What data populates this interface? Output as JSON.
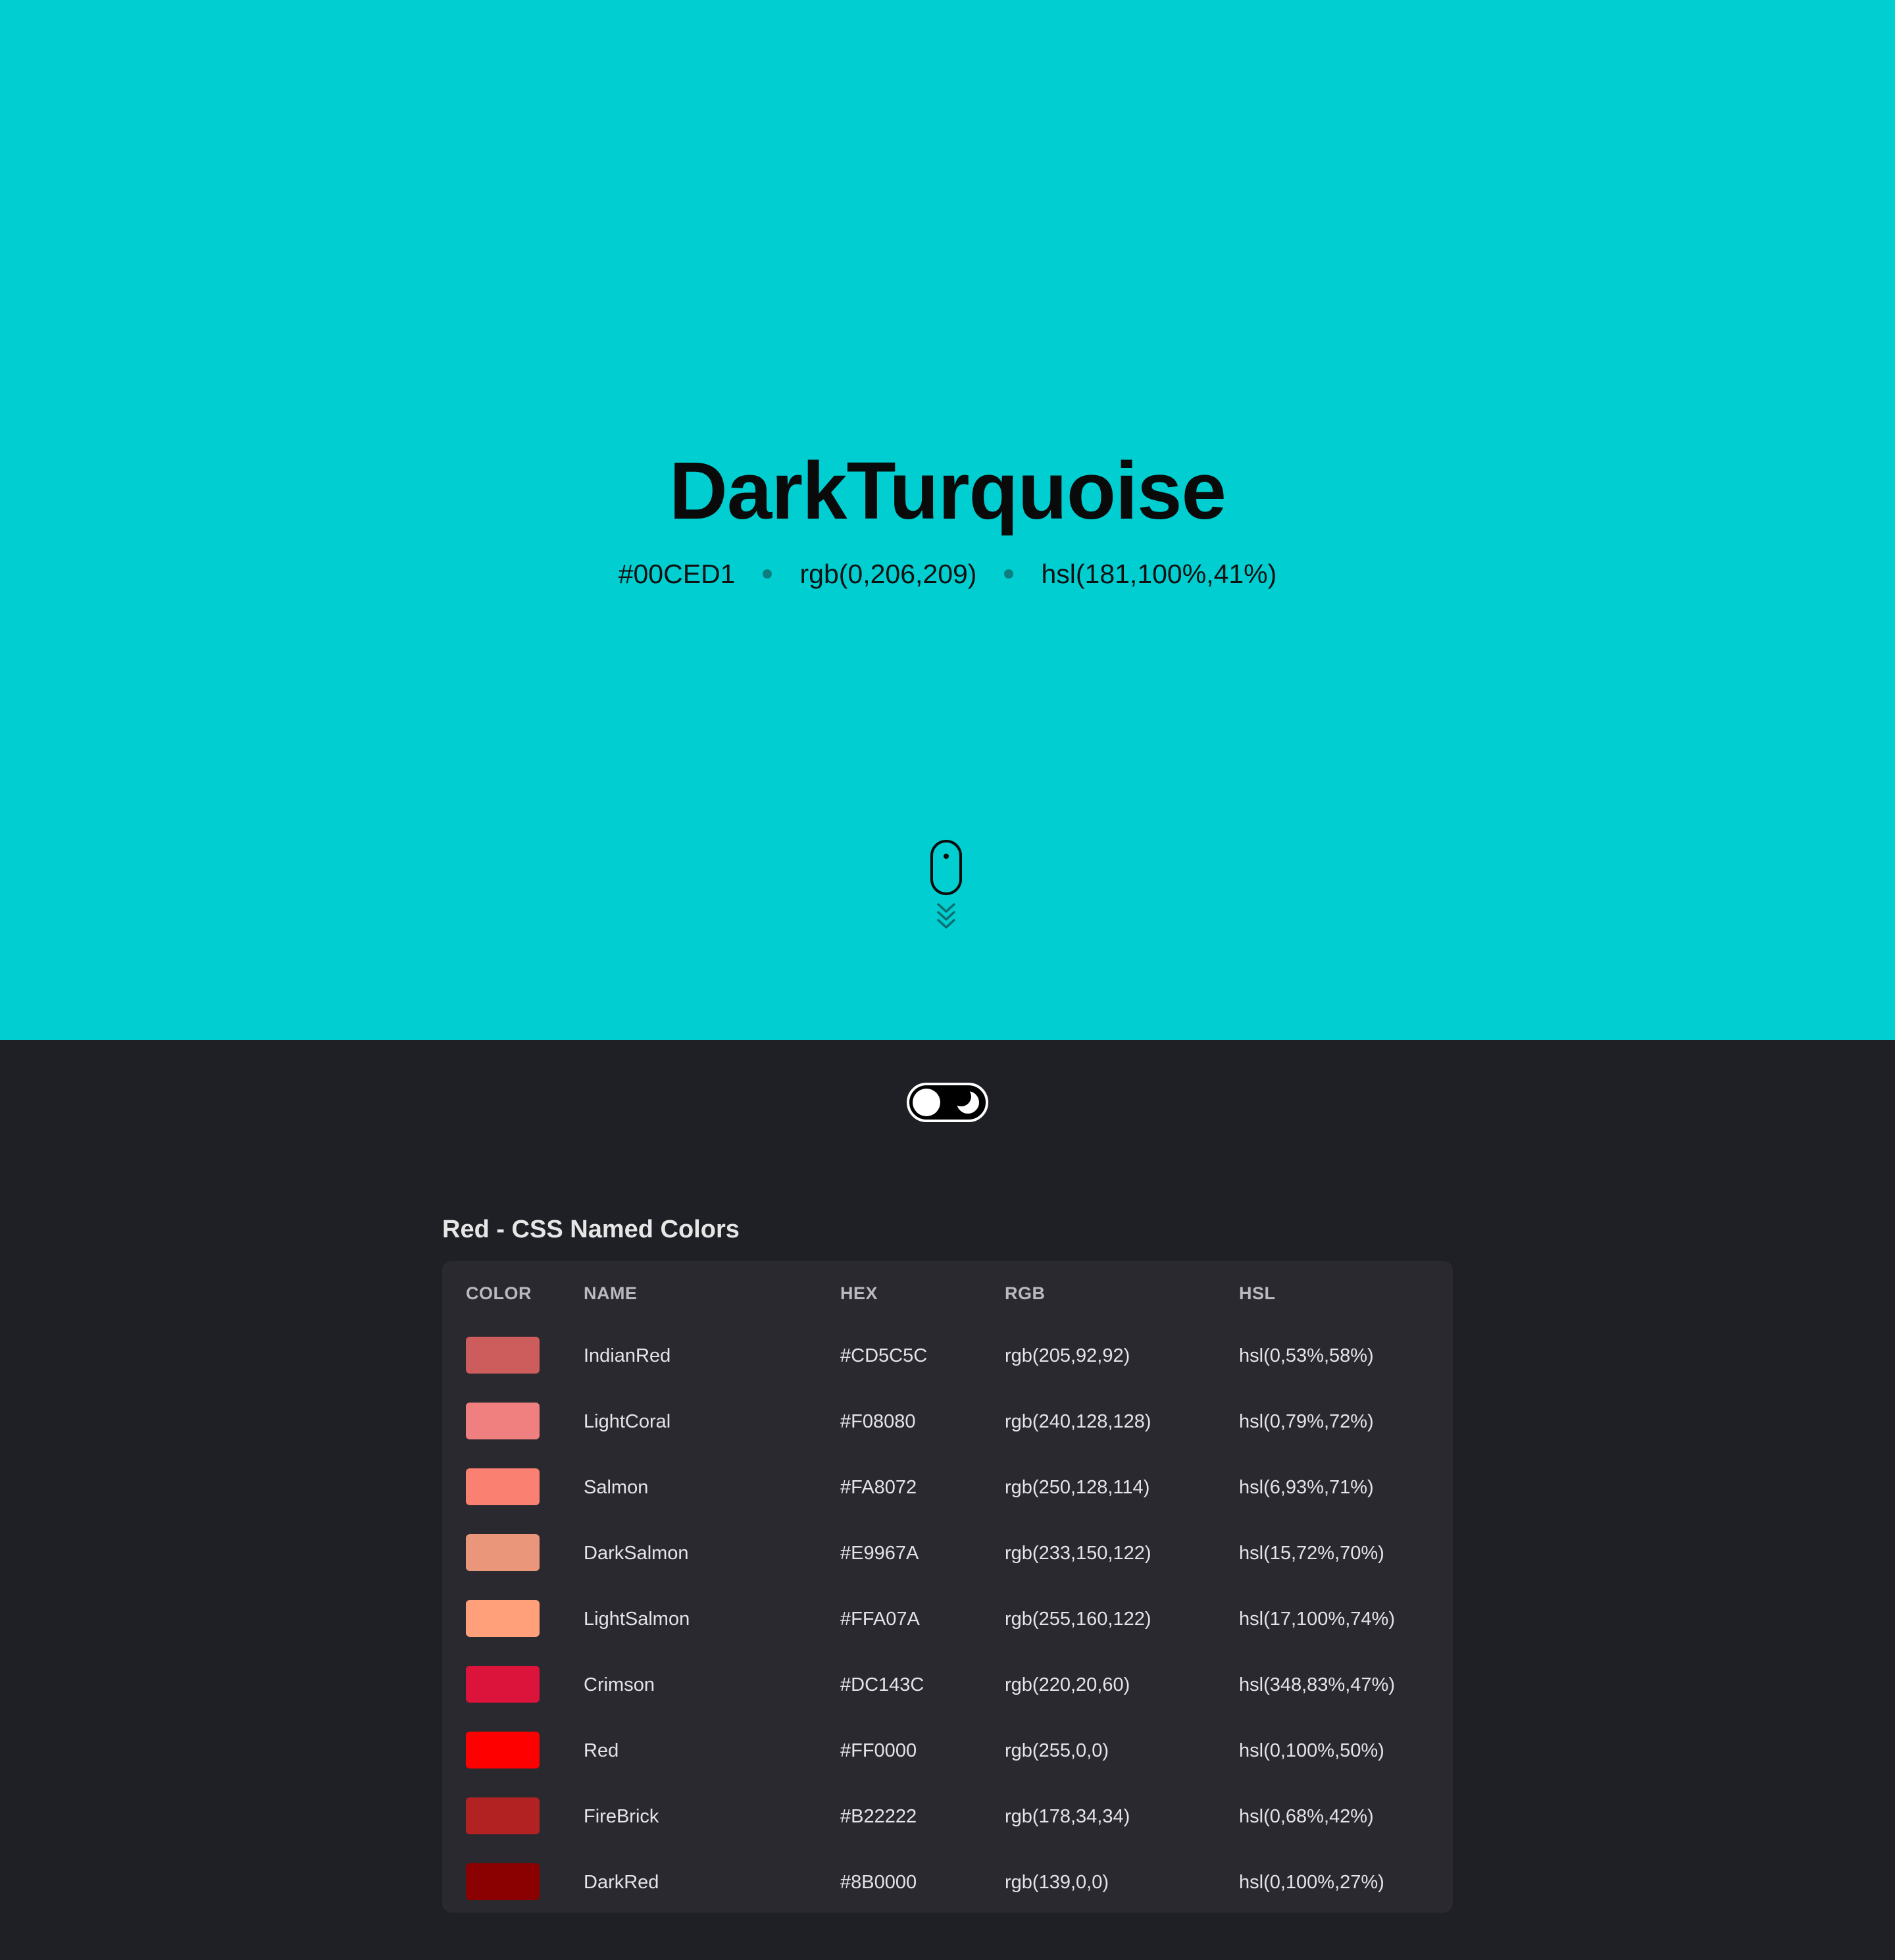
{
  "hero": {
    "name": "DarkTurquoise",
    "hex": "#00CED1",
    "rgb": "rgb(0,206,209)",
    "hsl": "hsl(181,100%,41%)",
    "background": "#00CED1"
  },
  "scroll_indicator": {
    "icon": "mouse-scroll-icon",
    "chevrons_icon": "chevrons-down-icon"
  },
  "theme_toggle": {
    "icon_left": "sun-circle-icon",
    "icon_right": "moon-icon",
    "mode": "dark"
  },
  "section": {
    "title": "Red - CSS Named Colors",
    "headers": {
      "color": "COLOR",
      "name": "NAME",
      "hex": "HEX",
      "rgb": "RGB",
      "hsl": "HSL"
    },
    "rows": [
      {
        "name": "IndianRed",
        "hex": "#CD5C5C",
        "rgb": "rgb(205,92,92)",
        "hsl": "hsl(0,53%,58%)"
      },
      {
        "name": "LightCoral",
        "hex": "#F08080",
        "rgb": "rgb(240,128,128)",
        "hsl": "hsl(0,79%,72%)"
      },
      {
        "name": "Salmon",
        "hex": "#FA8072",
        "rgb": "rgb(250,128,114)",
        "hsl": "hsl(6,93%,71%)"
      },
      {
        "name": "DarkSalmon",
        "hex": "#E9967A",
        "rgb": "rgb(233,150,122)",
        "hsl": "hsl(15,72%,70%)"
      },
      {
        "name": "LightSalmon",
        "hex": "#FFA07A",
        "rgb": "rgb(255,160,122)",
        "hsl": "hsl(17,100%,74%)"
      },
      {
        "name": "Crimson",
        "hex": "#DC143C",
        "rgb": "rgb(220,20,60)",
        "hsl": "hsl(348,83%,47%)"
      },
      {
        "name": "Red",
        "hex": "#FF0000",
        "rgb": "rgb(255,0,0)",
        "hsl": "hsl(0,100%,50%)"
      },
      {
        "name": "FireBrick",
        "hex": "#B22222",
        "rgb": "rgb(178,34,34)",
        "hsl": "hsl(0,68%,42%)"
      },
      {
        "name": "DarkRed",
        "hex": "#8B0000",
        "rgb": "rgb(139,0,0)",
        "hsl": "hsl(0,100%,27%)"
      }
    ]
  }
}
